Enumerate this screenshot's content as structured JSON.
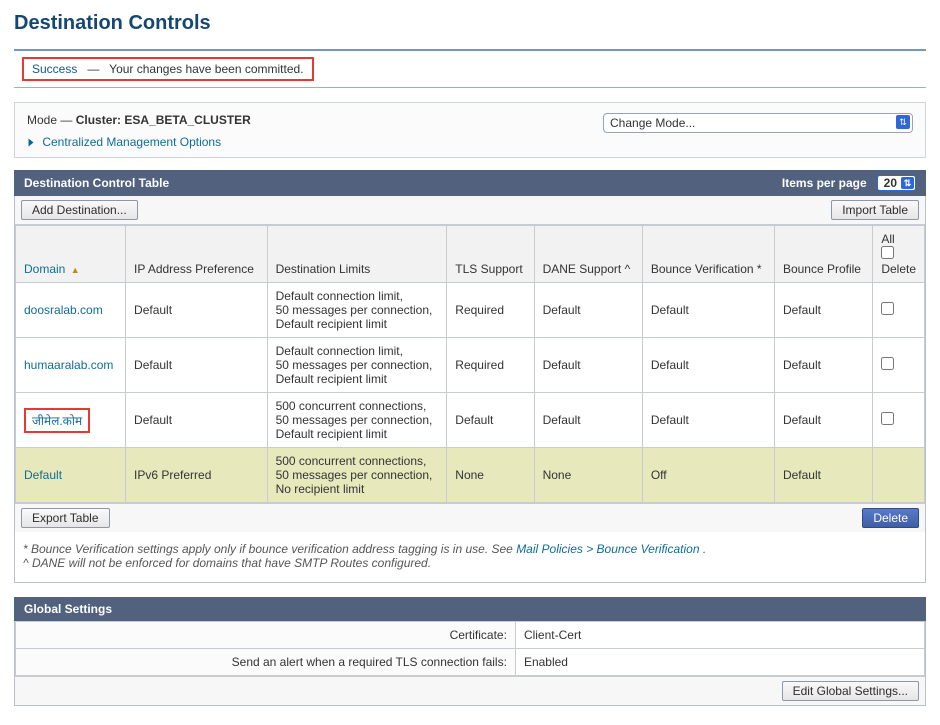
{
  "page_title": "Destination Controls",
  "success": {
    "label": "Success",
    "sep": "—",
    "message": "Your changes have been committed."
  },
  "mode": {
    "prefix": "Mode —",
    "cluster_label": "Cluster: ESA_BETA_CLUSTER",
    "change_mode": "Change Mode...",
    "cmo_label": "Centralized Management Options"
  },
  "dct": {
    "header": "Destination Control Table",
    "items_label": "Items per page",
    "items_value": "20",
    "add_btn": "Add Destination...",
    "import_btn": "Import Table",
    "export_btn": "Export Table",
    "delete_btn": "Delete",
    "columns": {
      "domain": "Domain",
      "ip_pref": "IP Address Preference",
      "dest_limits": "Destination Limits",
      "tls": "TLS Support",
      "dane": "DANE Support ^",
      "bounce_ver": "Bounce Verification *",
      "bounce_prof": "Bounce Profile",
      "all": "All",
      "delete": "Delete"
    },
    "rows": [
      {
        "domain": "doosralab.com",
        "ip_pref": "Default",
        "dest_limits": "Default connection limit,\n50 messages per connection,\nDefault recipient limit",
        "tls": "Required",
        "dane": "Default",
        "bounce_ver": "Default",
        "bounce_prof": "Default",
        "deletable": true,
        "highlight": false
      },
      {
        "domain": "humaaralab.com",
        "ip_pref": "Default",
        "dest_limits": "Default connection limit,\n50 messages per connection,\nDefault recipient limit",
        "tls": "Required",
        "dane": "Default",
        "bounce_ver": "Default",
        "bounce_prof": "Default",
        "deletable": true,
        "highlight": false
      },
      {
        "domain": "जीमेल.कोम",
        "ip_pref": "Default",
        "dest_limits": "500 concurrent connections,\n50 messages per connection,\nDefault recipient limit",
        "tls": "Default",
        "dane": "Default",
        "bounce_ver": "Default",
        "bounce_prof": "Default",
        "deletable": true,
        "highlight": true
      },
      {
        "domain": "Default",
        "ip_pref": "IPv6 Preferred",
        "dest_limits": "500 concurrent connections,\n50 messages per connection,\nNo recipient limit",
        "tls": "None",
        "dane": "None",
        "bounce_ver": "Off",
        "bounce_prof": "Default",
        "deletable": false,
        "default_row": true
      }
    ],
    "footnote1_a": "* Bounce Verification settings apply only if bounce verification address tagging is in use. See ",
    "footnote1_link": "Mail Policies > Bounce Verification",
    "footnote1_b": ".",
    "footnote2": "^ DANE will not be enforced for domains that have SMTP Routes configured."
  },
  "global": {
    "header": "Global Settings",
    "rows": [
      {
        "label": "Certificate:",
        "value": "Client-Cert"
      },
      {
        "label": "Send an alert when a required TLS connection fails:",
        "value": "Enabled"
      }
    ],
    "edit_btn": "Edit Global Settings..."
  }
}
